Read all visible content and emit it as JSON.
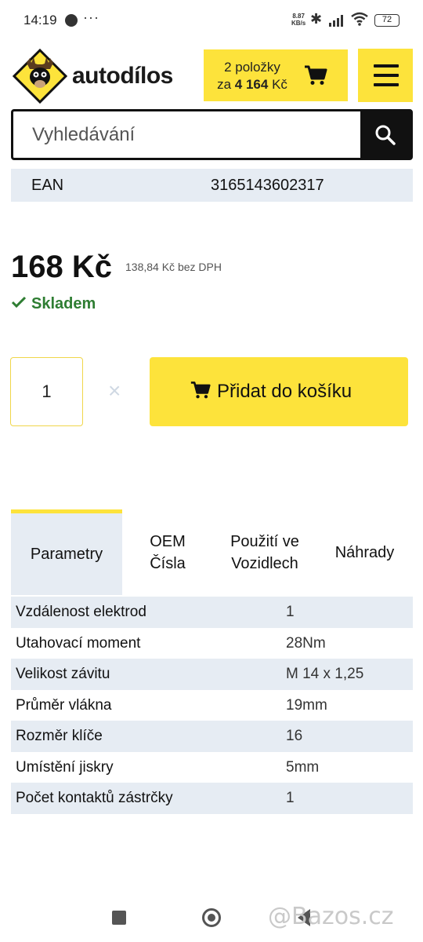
{
  "status_bar": {
    "time": "14:19",
    "more": "···",
    "net_speed_value": "8.87",
    "net_speed_unit": "KB/s",
    "battery": "72"
  },
  "header": {
    "logo_text": "autodílos",
    "cart_count": "2 položky",
    "cart_total_prefix": "za",
    "cart_total": "4 164",
    "cart_currency": "Kč"
  },
  "search": {
    "placeholder": "Vyhledávání"
  },
  "ean": {
    "label": "EAN",
    "value": "3165143602317"
  },
  "price": {
    "value": "168 Kč",
    "without_vat": "138,84 Kč bez DPH",
    "stock": "Skladem"
  },
  "purchase": {
    "quantity": "1",
    "remove_symbol": "×",
    "add_label": "Přidat do košíku"
  },
  "tabs": [
    {
      "label": "Parametry"
    },
    {
      "label": "OEM Čísla"
    },
    {
      "label": "Použití ve Vozidlech"
    },
    {
      "label": "Náhrady"
    }
  ],
  "params": [
    {
      "name": "Vzdálenost elektrod",
      "value": "1"
    },
    {
      "name": "Utahovací moment",
      "value": "28Nm"
    },
    {
      "name": "Velikost závitu",
      "value": "M 14 x 1,25"
    },
    {
      "name": "Průměr vlákna",
      "value": "19mm"
    },
    {
      "name": "Rozměr klíče",
      "value": "16"
    },
    {
      "name": "Umístění jiskry",
      "value": "5mm"
    },
    {
      "name": "Počet kontaktů zástrčky",
      "value": "1"
    }
  ],
  "watermark": "@Bazos.cz",
  "colors": {
    "brand_yellow": "#fde33b",
    "stock_green": "#2e7d32",
    "row_shade": "#e6ecf3"
  }
}
